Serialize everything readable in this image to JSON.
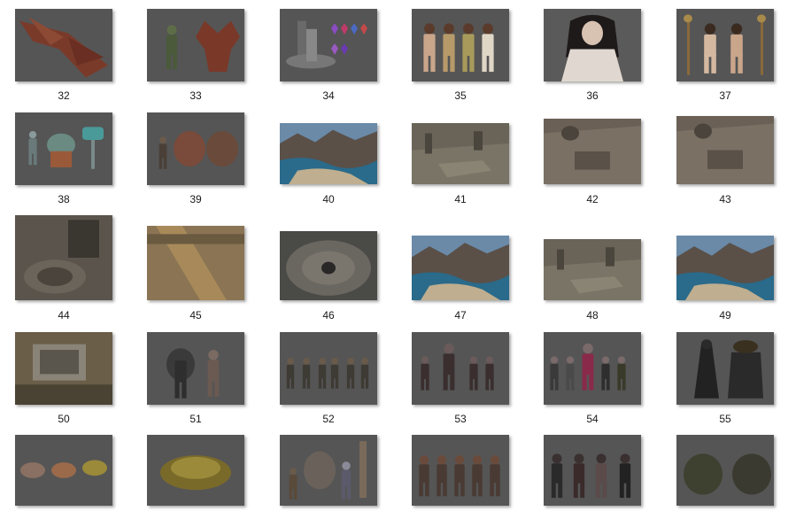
{
  "thumbnails": [
    {
      "label": "32",
      "kind": "dragon",
      "icon": "dragon-model-icon"
    },
    {
      "label": "33",
      "kind": "demons",
      "icon": "demon-models-icon"
    },
    {
      "label": "34",
      "kind": "altar",
      "icon": "altar-and-gems-icon"
    },
    {
      "label": "35",
      "kind": "figures4",
      "icon": "female-figures-icon"
    },
    {
      "label": "36",
      "kind": "portrait",
      "icon": "character-portrait-icon"
    },
    {
      "label": "37",
      "kind": "figures2staff",
      "icon": "figures-with-staffs-icon"
    },
    {
      "label": "38",
      "kind": "hammer",
      "icon": "warrior-hammer-icon"
    },
    {
      "label": "39",
      "kind": "ogres",
      "icon": "ogre-models-icon"
    },
    {
      "label": "40",
      "kind": "landscape",
      "icon": "landscape-scene-icon"
    },
    {
      "label": "41",
      "kind": "ruins",
      "icon": "ruins-scene-icon"
    },
    {
      "label": "42",
      "kind": "room",
      "icon": "stone-room-icon"
    },
    {
      "label": "43",
      "kind": "room2",
      "icon": "stone-room-icon"
    },
    {
      "label": "44",
      "kind": "dungeon",
      "icon": "dungeon-scene-icon"
    },
    {
      "label": "45",
      "kind": "bridge",
      "icon": "wooden-bridge-icon"
    },
    {
      "label": "46",
      "kind": "arena",
      "icon": "circular-arena-icon"
    },
    {
      "label": "47",
      "kind": "landscape2",
      "icon": "landscape-scene-icon"
    },
    {
      "label": "48",
      "kind": "ruins2",
      "icon": "ruins-scene-icon"
    },
    {
      "label": "49",
      "kind": "landscape3",
      "icon": "landscape-scene-icon"
    },
    {
      "label": "50",
      "kind": "courtyard",
      "icon": "courtyard-scene-icon"
    },
    {
      "label": "51",
      "kind": "armored2",
      "icon": "armored-warriors-icon"
    },
    {
      "label": "52",
      "kind": "figures6",
      "icon": "character-lineup-icon"
    },
    {
      "label": "53",
      "kind": "figures5",
      "icon": "character-lineup-icon"
    },
    {
      "label": "54",
      "kind": "figures6b",
      "icon": "character-lineup-icon"
    },
    {
      "label": "55",
      "kind": "cloaked2",
      "icon": "cloaked-figures-icon"
    },
    {
      "label": "",
      "kind": "beasts",
      "icon": "beast-models-icon"
    },
    {
      "label": "",
      "kind": "toad",
      "icon": "toad-creature-icon"
    },
    {
      "label": "",
      "kind": "giant",
      "icon": "giant-warriors-icon"
    },
    {
      "label": "",
      "kind": "figures5b",
      "icon": "character-lineup-icon"
    },
    {
      "label": "",
      "kind": "dark4",
      "icon": "dark-figures-icon"
    },
    {
      "label": "",
      "kind": "golems",
      "icon": "golem-models-icon"
    }
  ],
  "colors": {
    "tile_background": "#555555",
    "label_text": "#1a1a1a",
    "page_background": "#ffffff"
  }
}
